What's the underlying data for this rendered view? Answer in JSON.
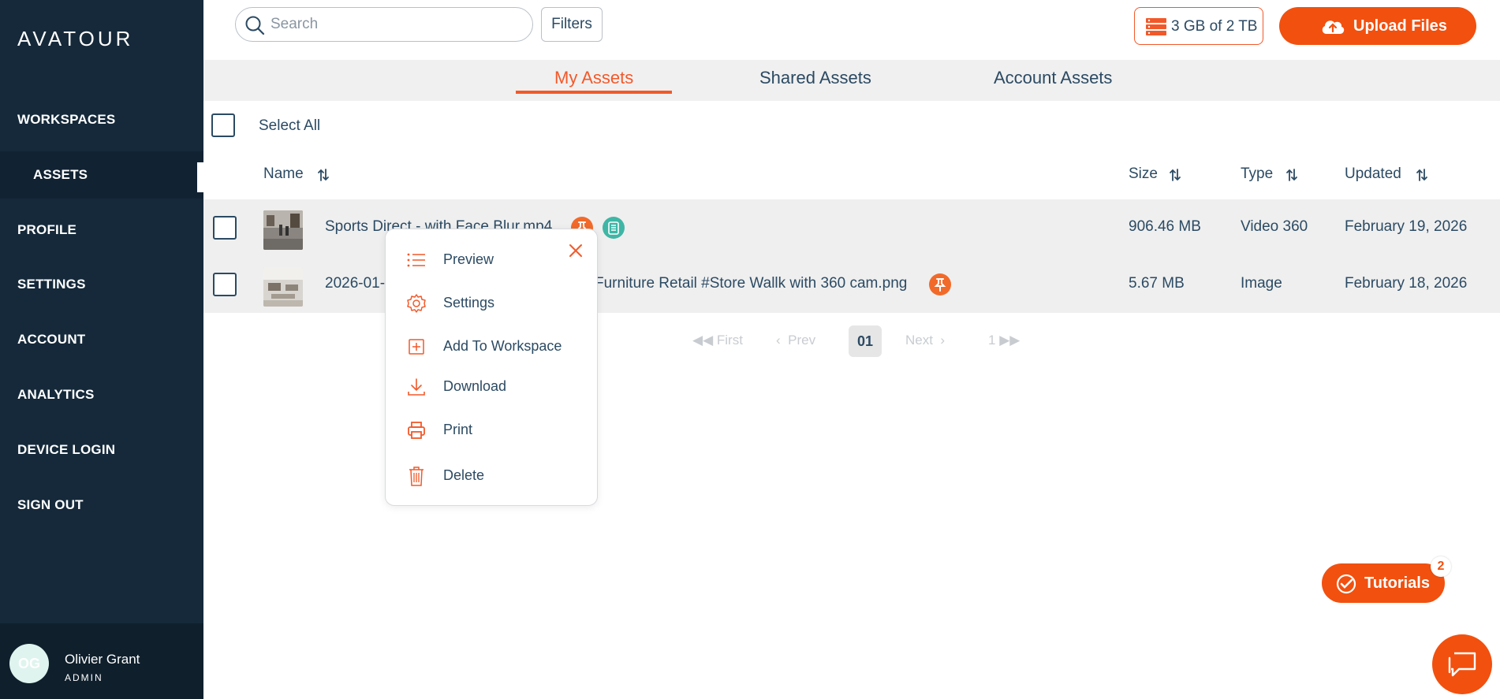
{
  "app": {
    "logo": "AVATOUR"
  },
  "sidebar": {
    "items": [
      {
        "label": "WORKSPACES"
      },
      {
        "label": "ASSETS"
      },
      {
        "label": "PROFILE"
      },
      {
        "label": "SETTINGS"
      },
      {
        "label": "ACCOUNT"
      },
      {
        "label": "ANALYTICS"
      },
      {
        "label": "DEVICE LOGIN"
      },
      {
        "label": "SIGN OUT"
      }
    ],
    "active": "ASSETS",
    "user": {
      "initials": "OG",
      "name": "Olivier Grant",
      "role": "ADMIN"
    }
  },
  "topbar": {
    "search_placeholder": "Search",
    "filters_label": "Filters",
    "storage_label": "3 GB of 2 TB",
    "upload_label": "Upload Files"
  },
  "tabs": [
    {
      "label": "My Assets",
      "active": true
    },
    {
      "label": "Shared Assets",
      "active": false
    },
    {
      "label": "Account Assets",
      "active": false
    }
  ],
  "list": {
    "select_all_label": "Select All",
    "columns": {
      "name": "Name",
      "size": "Size",
      "type": "Type",
      "updated": "Updated"
    },
    "rows": [
      {
        "name": "Sports Direct - with Face Blur.mp4",
        "size": "906.46 MB",
        "type": "Video 360",
        "updated": "February 19, 2026"
      },
      {
        "name_start": "2026-01-",
        "name_end": "Furniture Retail #Store Wallk with 360 cam.png",
        "size": "5.67 MB",
        "type": "Image",
        "updated": "February 18, 2026"
      }
    ]
  },
  "pagination": {
    "first": "First",
    "prev": "Prev",
    "current": "01",
    "next": "Next",
    "last": "1"
  },
  "context_menu": {
    "items": [
      {
        "label": "Preview",
        "icon": "list-icon"
      },
      {
        "label": "Settings",
        "icon": "gear-icon"
      },
      {
        "label": "Add To Workspace",
        "icon": "add-square-icon"
      },
      {
        "label": "Download",
        "icon": "download-icon"
      },
      {
        "label": "Print",
        "icon": "printer-icon"
      },
      {
        "label": "Delete",
        "icon": "trash-icon"
      }
    ]
  },
  "tutorials": {
    "label": "Tutorials",
    "badge": "2"
  },
  "colors": {
    "accent": "#f2500f",
    "sidebar": "#15293a",
    "text": "#2b4a63",
    "teal": "#3fb6a6"
  }
}
